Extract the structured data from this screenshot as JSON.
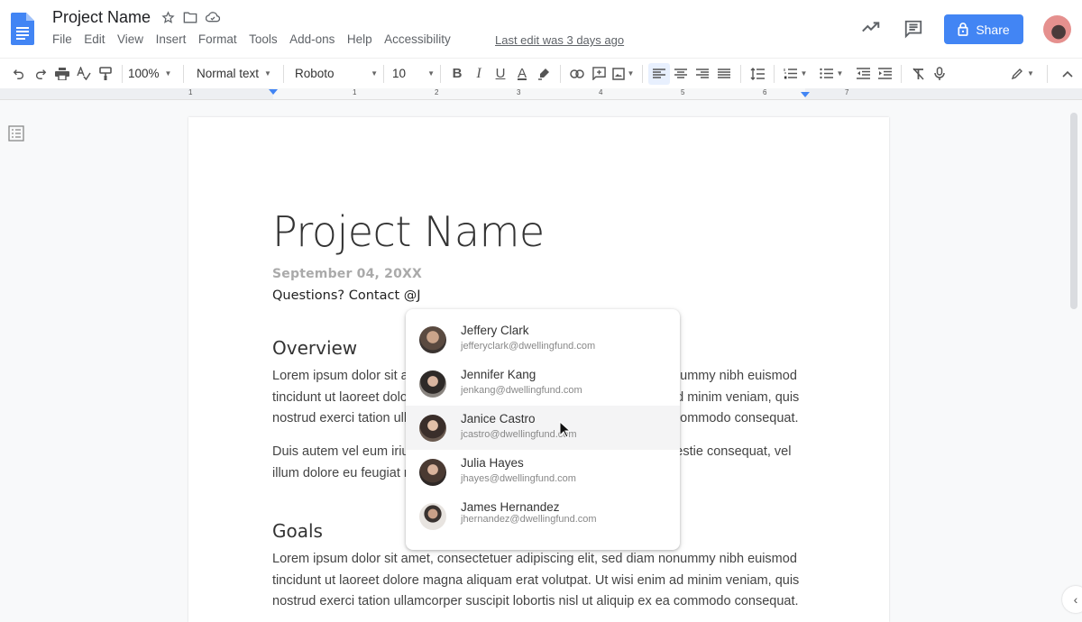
{
  "app": {
    "doc_title": "Project Name",
    "last_edit": "Last edit was 3 days ago",
    "share_label": "Share",
    "accent_color": "#4285f4"
  },
  "menu": [
    "File",
    "Edit",
    "View",
    "Insert",
    "Format",
    "Tools",
    "Add-ons",
    "Help",
    "Accessibility"
  ],
  "toolbar": {
    "zoom": "100%",
    "style": "Normal text",
    "font": "Roboto",
    "font_size": "10",
    "icons": [
      "undo-icon",
      "redo-icon",
      "print-icon",
      "spellcheck-icon",
      "paint-format-icon",
      "bold-icon",
      "italic-icon",
      "underline-icon",
      "text-color-icon",
      "highlight-icon",
      "link-icon",
      "add-comment-icon",
      "insert-image-icon",
      "align-left-icon",
      "align-center-icon",
      "align-right-icon",
      "justify-icon",
      "line-spacing-icon",
      "numbered-list-icon",
      "bulleted-list-icon",
      "decrease-indent-icon",
      "increase-indent-icon",
      "clear-formatting-icon",
      "voice-typing-icon",
      "editing-mode-icon",
      "collapse-icon"
    ],
    "bold": "B",
    "italic": "I",
    "underline": "U",
    "text_color": "A"
  },
  "ruler": {
    "labels": [
      "1",
      "1",
      "2",
      "3",
      "4",
      "5",
      "6",
      "7"
    ]
  },
  "document": {
    "title": "Project Name",
    "date": "September 04, 20XX",
    "contact": "Questions? Contact @J",
    "sections": [
      {
        "heading": "Overview",
        "paragraphs": [
          [
            "Lorem ipsum dolor sit amet, consectetuer adipiscing elit, sed diam nonummy nibh euismod",
            "tincidunt ut laoreet dolore magna aliquam erat volutpat. Ut wisi enim ad minim veniam, quis",
            "nostrud exerci tation ullamcorper suscipit lobortis nisl ut aliquip ex ea commodo consequat."
          ],
          [
            "Duis autem vel eum iriure dolor in hendrerit in vulputate velit esse molestie consequat, vel",
            "illum dolore eu feugiat nulla facilisis."
          ]
        ]
      },
      {
        "heading": "Goals",
        "paragraphs": [
          [
            "Lorem ipsum dolor sit amet, consectetuer adipiscing elit, sed diam nonummy nibh euismod",
            "tincidunt ut laoreet dolore magna aliquam erat volutpat. Ut wisi enim ad minim veniam, quis",
            "nostrud exerci tation ullamcorper suscipit lobortis nisl ut aliquip ex ea commodo consequat."
          ]
        ]
      }
    ]
  },
  "mention_suggestions": {
    "hovered_index": 2,
    "items": [
      {
        "name": "Jeffery Clark",
        "email": "jefferyclark@dwellingfund.com",
        "avatar_color": "#6b5a4e"
      },
      {
        "name": "Jennifer Kang",
        "email": "jenkang@dwellingfund.com",
        "avatar_color": "#3b3634"
      },
      {
        "name": "Janice Castro",
        "email": "jcastro@dwellingfund.com",
        "avatar_color": "#4a3a34"
      },
      {
        "name": "Julia Hayes",
        "email": "jhayes@dwellingfund.com",
        "avatar_color": "#5b4a42"
      },
      {
        "name": "James Hernandez",
        "email": "jhernandez@dwellingfund.com",
        "avatar_color": "#c9b8aa"
      }
    ]
  }
}
